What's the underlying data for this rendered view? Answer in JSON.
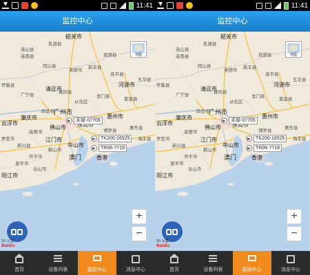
{
  "status_bar": {
    "time": "11:41"
  },
  "title": "监控中心",
  "map": {
    "map_type_label": "地图",
    "zoom_in": "+",
    "zoom_out": "−",
    "scale_label": "50 公里",
    "logo": "Baidu",
    "cities": [
      "广州市",
      "惠州市",
      "佛山市",
      "东莞市",
      "肇庆市",
      "江门市",
      "中山市",
      "澳门",
      "香港",
      "清远市",
      "河源市",
      "云浮市",
      "阳江市",
      "韶关市"
    ],
    "places": [
      "乳源县",
      "连山县",
      "连南县",
      "阳山县",
      "英德市",
      "新丰县",
      "翁源县",
      "连平县",
      "龙门县",
      "从化区",
      "佛冈县",
      "博罗县",
      "广宁县",
      "四会市",
      "怀集县",
      "罗定市",
      "新兴县",
      "高要市",
      "鹤山市",
      "开平市",
      "台山市",
      "恩平市",
      "紫金县",
      "海丰县",
      "惠东县",
      "五华县"
    ],
    "vehicles": [
      "天琴-07705",
      "TK200-16525",
      "TR06-7719"
    ]
  },
  "tabs": [
    {
      "label": "首页",
      "icon": "home-icon",
      "active": false
    },
    {
      "label": "设备列表",
      "icon": "list-icon",
      "active": false
    },
    {
      "label": "监控中心",
      "icon": "monitor-icon",
      "active": true
    },
    {
      "label": "消息中心",
      "icon": "message-icon",
      "active": false
    }
  ],
  "colors": {
    "title_bar": "#1f8ddb",
    "tab_active": "#f08a1d",
    "tab_bar": "#2b2b2b",
    "sea": "#b7d2ea"
  }
}
